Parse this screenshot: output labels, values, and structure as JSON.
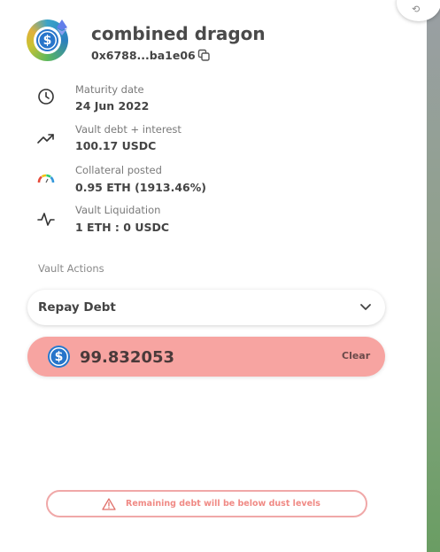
{
  "vault": {
    "name": "combined dragon",
    "address": "0x6788...ba1e06"
  },
  "info": [
    {
      "label": "Maturity date",
      "value": "24 Jun 2022",
      "icon": "clock-icon"
    },
    {
      "label": "Vault debt + interest",
      "value": "100.17 USDC",
      "icon": "trending-up-icon"
    },
    {
      "label": "Collateral posted",
      "value": "0.95 ETH  (1913.46%)",
      "icon": "gauge-icon"
    },
    {
      "label": "Vault Liquidation",
      "value": "1 ETH : 0 USDC",
      "icon": "activity-icon"
    }
  ],
  "actions": {
    "title": "Vault Actions",
    "selected": "Repay Debt"
  },
  "amount": {
    "value": "99.832053",
    "clear_label": "Clear",
    "token": "USDC"
  },
  "warning": {
    "text": "Remaining debt will be below dust levels"
  },
  "colors": {
    "accent_error": "#f7a4a1",
    "warning_text": "#f08a85",
    "usdc_blue": "#2775ca"
  }
}
